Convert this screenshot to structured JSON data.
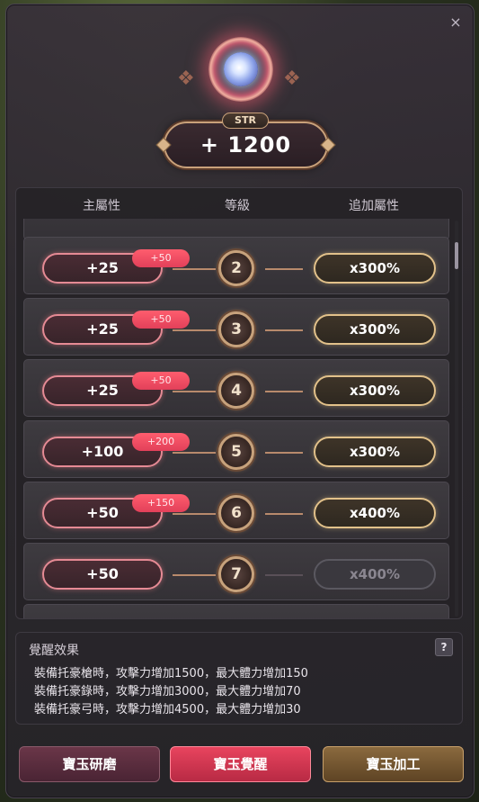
{
  "window": {
    "close_glyph": "×"
  },
  "gem": {
    "icon": "gem-icon"
  },
  "stat": {
    "label": "STR",
    "value": "+ 1200"
  },
  "table": {
    "headers": {
      "main": "主屬性",
      "level": "等級",
      "extra": "追加屬性"
    },
    "rows": [
      {
        "main": "+25",
        "bonus": "+50",
        "level": "2",
        "extra": "x300%",
        "active": true
      },
      {
        "main": "+25",
        "bonus": "+50",
        "level": "3",
        "extra": "x300%",
        "active": true
      },
      {
        "main": "+25",
        "bonus": "+50",
        "level": "4",
        "extra": "x300%",
        "active": true
      },
      {
        "main": "+100",
        "bonus": "+200",
        "level": "5",
        "extra": "x300%",
        "active": true
      },
      {
        "main": "+50",
        "bonus": "+150",
        "level": "6",
        "extra": "x400%",
        "active": true
      },
      {
        "main": "+50",
        "bonus": "",
        "level": "7",
        "extra": "x400%",
        "active": false
      }
    ]
  },
  "effect": {
    "title": "覺醒效果",
    "help": "?",
    "lines": [
      "裝備托豪槍時，攻擊力增加1500，最大體力增加150",
      "裝備托豪錄時，攻擊力增加3000，最大體力增加70",
      "裝備托豪弓時，攻擊力增加4500，最大體力增加30"
    ]
  },
  "buttons": {
    "polish": "寶玉研磨",
    "awaken": "寶玉覺醒",
    "process": "寶玉加工"
  }
}
